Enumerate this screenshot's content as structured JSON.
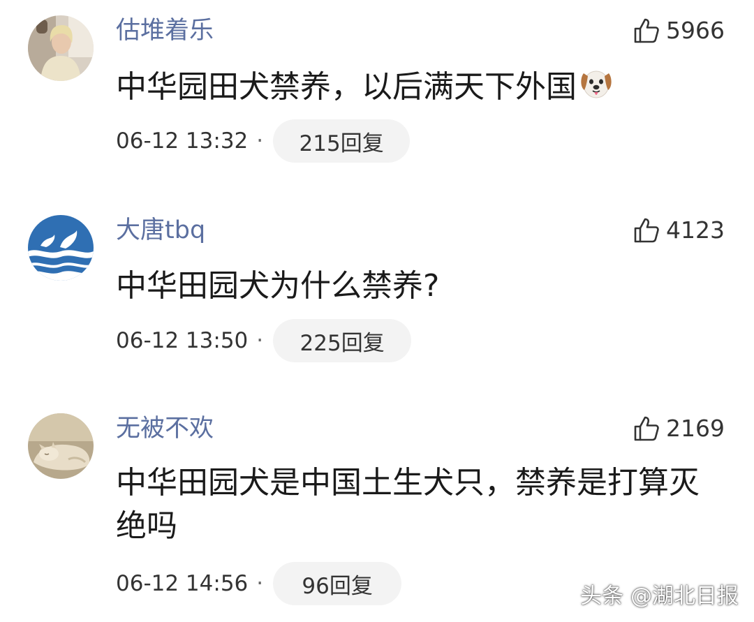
{
  "theme": {
    "username_color": "#5b6fa0",
    "text_color": "#1a1a1a",
    "meta_color": "#333333",
    "pill_background": "#f3f3f3"
  },
  "comments": [
    {
      "username": "估堆着乐",
      "avatar_icon": "woman-portrait-avatar",
      "likes": "5966",
      "content": "中华园田犬禁养，以后满天下外国",
      "content_emoji": "dog-face-emoji",
      "timestamp": "06-12 13:32",
      "separator": "·",
      "reply_label": "215回复"
    },
    {
      "username": "大唐tbq",
      "avatar_icon": "blue-wave-logo-avatar",
      "likes": "4123",
      "content": "中华田园犬为什么禁养?",
      "timestamp": "06-12 13:50",
      "separator": "·",
      "reply_label": "225回复"
    },
    {
      "username": "无被不欢",
      "avatar_icon": "sleeping-cat-avatar",
      "likes": "2169",
      "content": "中华田园犬是中国土生犬只，禁养是打算灭绝吗",
      "timestamp": "06-12 14:56",
      "separator": "·",
      "reply_label": "96回复"
    }
  ],
  "watermark": "头条 @湖北日报"
}
